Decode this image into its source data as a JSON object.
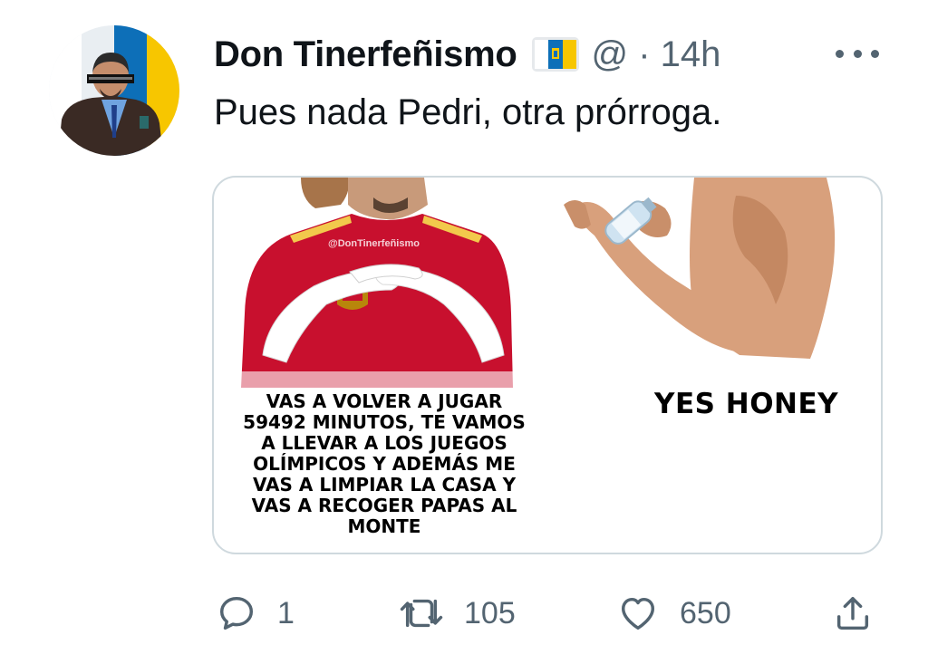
{
  "tweet": {
    "author_name": "Don Tinerfeñismo",
    "handle_time": "@ · 14h",
    "text": "Pues nada Pedri, otra prórroga."
  },
  "icons": {
    "avatar": "profile-photo",
    "flag": "canary-islands-flag-icon",
    "more": "more-options-icon",
    "reply": "reply-icon",
    "retweet": "retweet-icon",
    "like": "heart-icon",
    "share": "share-icon"
  },
  "meme": {
    "watermark": "@DonTinerfeñismo",
    "left_caption": "VAS A VOLVER A JUGAR\n59492 MINUTOS, TE VAMOS\nA LLEVAR A LOS JUEGOS\nOLÍMPICOS Y ADEMÁS ME\nVAS A LIMPIAR LA CASA Y\nVAS A RECOGER PAPAS AL\nMONTE",
    "right_caption": "YES HONEY"
  },
  "actions": {
    "replies": "1",
    "retweets": "105",
    "likes": "650"
  },
  "colors": {
    "text": "#0f1419",
    "secondary": "#536471",
    "border": "#cfd9de",
    "flag_blue": "#0d6fb8",
    "flag_yellow": "#f7c600",
    "jersey_red": "#c8102e"
  }
}
